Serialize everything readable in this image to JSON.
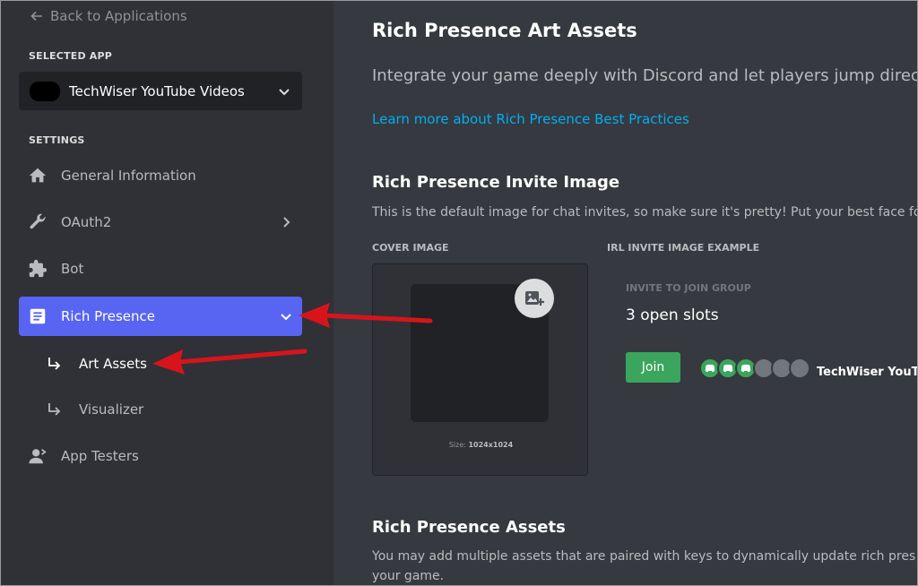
{
  "sidebar": {
    "back_label": "Back to Applications",
    "selected_app_label": "SELECTED APP",
    "app_name": "TechWiser YouTube Videos",
    "settings_label": "SETTINGS",
    "items": [
      {
        "label": "General Information",
        "icon": "home-icon"
      },
      {
        "label": "OAuth2",
        "icon": "wrench-icon"
      },
      {
        "label": "Bot",
        "icon": "puzzle-icon"
      },
      {
        "label": "Rich Presence",
        "icon": "document-icon",
        "active": true
      },
      {
        "label": "App Testers",
        "icon": "user-icon"
      }
    ],
    "sub_items": [
      {
        "label": "Art Assets",
        "active": true
      },
      {
        "label": "Visualizer"
      }
    ]
  },
  "main": {
    "title": "Rich Presence Art Assets",
    "intro": "Integrate your game deeply with Discord and let players jump directly",
    "learn_link": "Learn more about Rich Presence Best Practices",
    "invite_section": {
      "title": "Rich Presence Invite Image",
      "description": "This is the default image for chat invites, so make sure it's pretty! Put your best face fo",
      "cover_label": "COVER IMAGE",
      "example_label": "IRL INVITE IMAGE EXAMPLE",
      "size_prefix": "Size:",
      "size_value": "1024x1024",
      "invite_to_join": "INVITE TO JOIN GROUP",
      "open_slots": "3 open slots",
      "join_label": "Join",
      "app_name": "TechWiser YouTu"
    },
    "assets_section": {
      "title": "Rich Presence Assets",
      "description_line1": "You may add multiple assets that are paired with keys to dynamically update rich pres",
      "description_line2": "your game."
    }
  },
  "colors": {
    "accent": "#5865f2",
    "link": "#00aff4",
    "join": "#3ba55d",
    "annotation_arrow": "#d8141b"
  }
}
